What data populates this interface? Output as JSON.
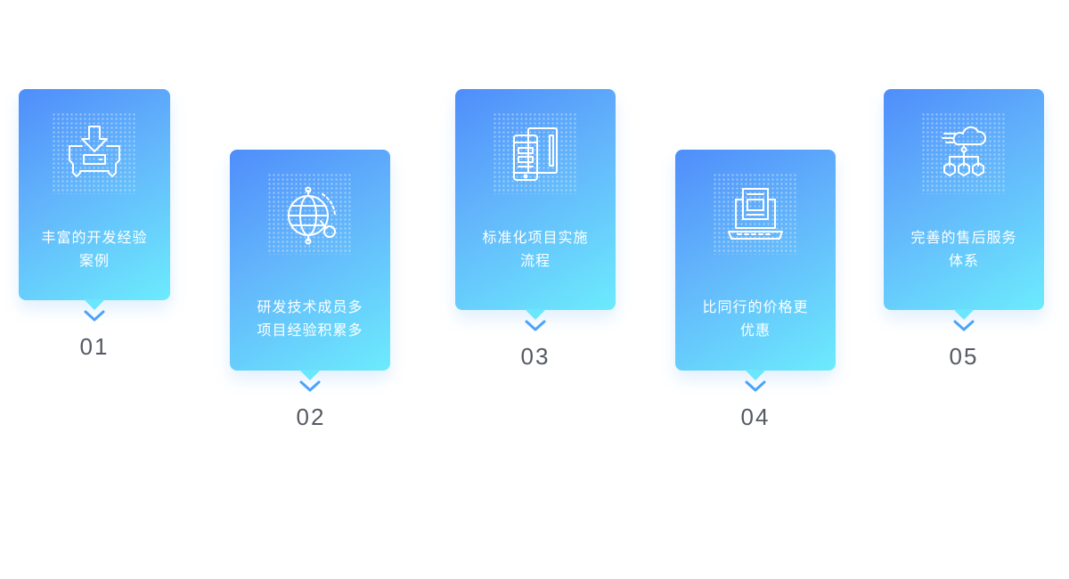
{
  "colors": {
    "gradient_start": "#4f8dfb",
    "gradient_end": "#6cebfd",
    "chevron": "#4aa4f7",
    "number_text": "#555a63"
  },
  "cards": [
    {
      "number": "01",
      "line1": "丰富的开发经验",
      "line2": "案例",
      "icon": "download-device-icon"
    },
    {
      "number": "02",
      "line1": "研发技术成员多",
      "line2": "项目经验积累多",
      "icon": "globe-search-icon"
    },
    {
      "number": "03",
      "line1": "标准化项目实施",
      "line2": "流程",
      "icon": "tablet-phone-icon"
    },
    {
      "number": "04",
      "line1": "比同行的价格更",
      "line2": "优惠",
      "icon": "laptop-document-icon"
    },
    {
      "number": "05",
      "line1": "完善的售后服务",
      "line2": "体系",
      "icon": "cloud-network-icon"
    }
  ]
}
